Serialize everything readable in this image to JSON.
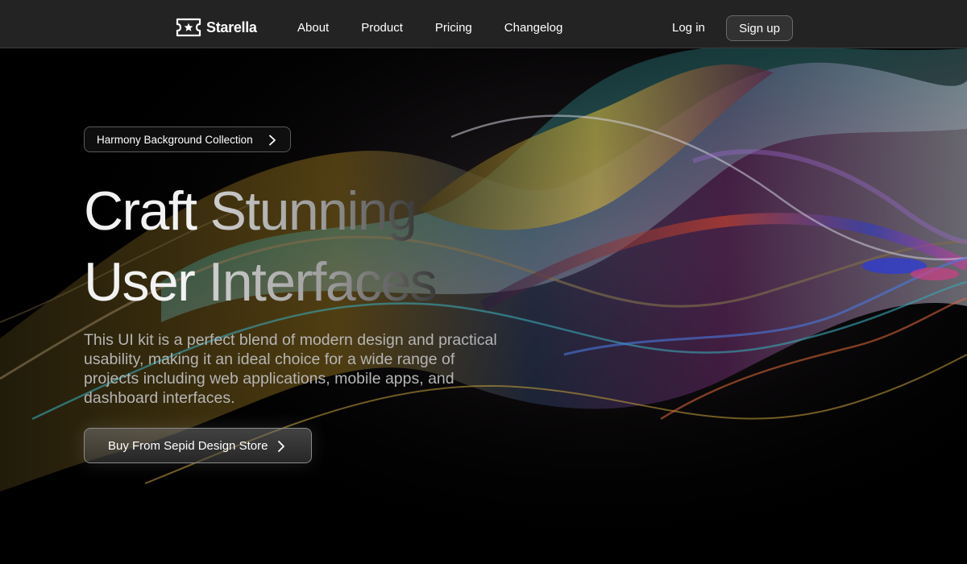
{
  "brand": {
    "name": "Starella",
    "logo_icon": "ticket-star-icon"
  },
  "nav": {
    "items": [
      {
        "label": "About"
      },
      {
        "label": "Product"
      },
      {
        "label": "Pricing"
      },
      {
        "label": "Changelog"
      }
    ],
    "login_label": "Log in",
    "signup_label": "Sign up"
  },
  "hero": {
    "pill_label": "Harmony Background Collection",
    "headline": {
      "line1_word1": "Craft",
      "line1_rest": "Stunning",
      "line2_word1": "User",
      "line2_rest": "Interfaces"
    },
    "description": "This UI kit is a perfect blend of modern design and practical usability, making it an ideal choice for a wide range of projects including web applications, mobile apps, and dashboard interfaces.",
    "cta_label": "Buy From Sepid Design Store"
  },
  "colors": {
    "background": "#000000",
    "topbar": "#262626",
    "text_primary": "#ffffff",
    "text_muted": "#b5b5b5"
  }
}
